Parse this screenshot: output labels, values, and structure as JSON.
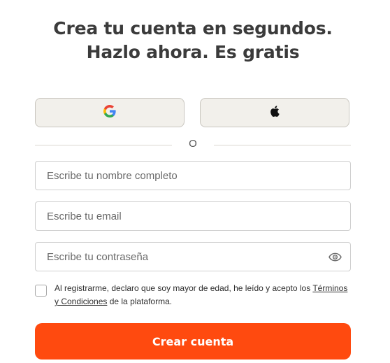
{
  "header": {
    "title_line1": "Crea tu cuenta en segundos.",
    "title_line2": "Hazlo ahora. Es gratis"
  },
  "social": {
    "google_icon": "google-icon",
    "apple_icon": "apple-icon"
  },
  "divider": {
    "text": "O"
  },
  "form": {
    "name_placeholder": "Escribe tu nombre completo",
    "email_placeholder": "Escribe tu email",
    "password_placeholder": "Escribe tu contraseña",
    "password_toggle_icon": "eye-icon"
  },
  "terms": {
    "text_before": "Al registrarme, declaro que soy mayor de edad, he leído y acepto los ",
    "link_text": "Términos y Condiciones",
    "text_after": " de la plataforma."
  },
  "submit": {
    "label": "Crear cuenta"
  },
  "colors": {
    "primary": "#ff4a0f",
    "social_button_bg": "#f2f0eb",
    "title": "#3b3b3b"
  }
}
